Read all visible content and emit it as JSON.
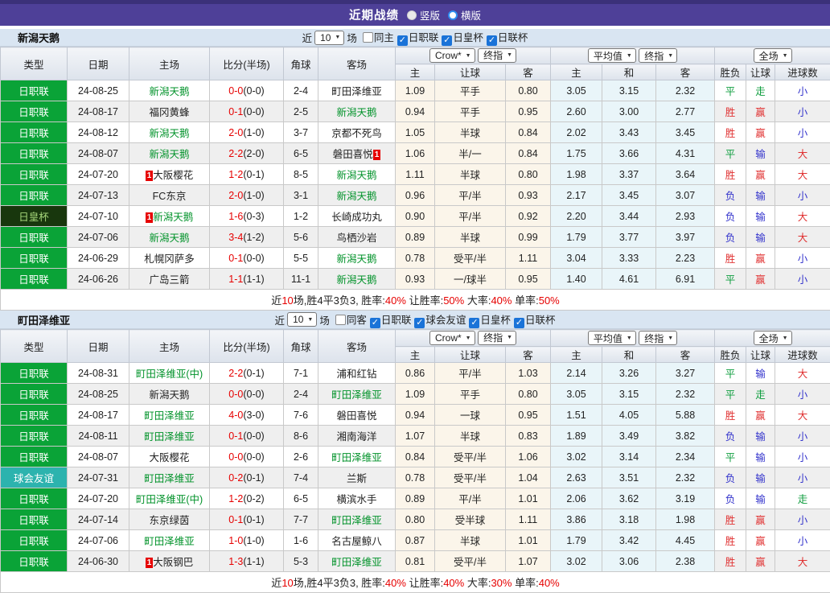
{
  "title_bar": {
    "title": "近期战绩",
    "radios": [
      {
        "label": "竖版",
        "checked": false
      },
      {
        "label": "横版",
        "checked": true
      }
    ]
  },
  "colors": {
    "titlebar_purple": "#4e4098",
    "league_green": "#0aa337",
    "cup_dark_green": "#18370d",
    "friendly_teal": "#2cb3ae",
    "focus_team_green": "#009229",
    "score_red": "#e60000",
    "win_red": "#e03131",
    "draw_green": "#0c9c3c",
    "lose_blue": "#3333cc",
    "checkbox_blue": "#1a73d8"
  },
  "columns": {
    "type": "类型",
    "date": "日期",
    "home": "主场",
    "score": "比分(半场)",
    "corner": "角球",
    "away": "客场",
    "crow_home": "主",
    "crow_handicap": "让球",
    "crow_away": "客",
    "avg_home": "主",
    "avg_draw": "和",
    "avg_away": "客",
    "res_wl": "胜负",
    "res_handicap": "让球",
    "res_goals": "进球数"
  },
  "sections": [
    {
      "team": "新潟天鹅",
      "controls": {
        "near_label": "近",
        "count": "10",
        "games_label": "场",
        "same_label": "同主",
        "same_checked": false,
        "leagues": [
          {
            "label": "日职联",
            "checked": true
          },
          {
            "label": "日皇杯",
            "checked": true
          },
          {
            "label": "日联杯",
            "checked": true
          }
        ]
      },
      "selectors": {
        "crow": "Crow*",
        "crow_idx": "终指",
        "avg": "平均值",
        "avg_idx": "终指",
        "full": "全场"
      },
      "rows": [
        {
          "type": "日职联",
          "type_style": "league",
          "date": "24-08-25",
          "home": {
            "name": "新潟天鹅",
            "focus": true,
            "badge": null
          },
          "score": "0-0",
          "half": "(0-0)",
          "corner": "2-4",
          "away": {
            "name": "町田泽维亚",
            "focus": false,
            "badge": null
          },
          "odds": [
            "1.09",
            "平手",
            "0.80",
            "3.05",
            "3.15",
            "2.32"
          ],
          "results": [
            [
              "平",
              "green"
            ],
            [
              "走",
              "green"
            ],
            [
              "小",
              "blue"
            ]
          ]
        },
        {
          "type": "日职联",
          "type_style": "league",
          "date": "24-08-17",
          "home": {
            "name": "福冈黄蜂",
            "focus": false,
            "badge": null
          },
          "score": "0-1",
          "half": "(0-0)",
          "corner": "2-5",
          "away": {
            "name": "新潟天鹅",
            "focus": true,
            "badge": null
          },
          "odds": [
            "0.94",
            "平手",
            "0.95",
            "2.60",
            "3.00",
            "2.77"
          ],
          "results": [
            [
              "胜",
              "red"
            ],
            [
              "赢",
              "red"
            ],
            [
              "小",
              "blue"
            ]
          ]
        },
        {
          "type": "日职联",
          "type_style": "league",
          "date": "24-08-12",
          "home": {
            "name": "新潟天鹅",
            "focus": true,
            "badge": null
          },
          "score": "2-0",
          "half": "(1-0)",
          "corner": "3-7",
          "away": {
            "name": "京都不死鸟",
            "focus": false,
            "badge": null
          },
          "odds": [
            "1.05",
            "半球",
            "0.84",
            "2.02",
            "3.43",
            "3.45"
          ],
          "results": [
            [
              "胜",
              "red"
            ],
            [
              "赢",
              "red"
            ],
            [
              "小",
              "blue"
            ]
          ]
        },
        {
          "type": "日职联",
          "type_style": "league",
          "date": "24-08-07",
          "home": {
            "name": "新潟天鹅",
            "focus": true,
            "badge": null
          },
          "score": "2-2",
          "half": "(2-0)",
          "corner": "6-5",
          "away": {
            "name": "磐田喜悦",
            "focus": false,
            "badge": "after"
          },
          "odds": [
            "1.06",
            "半/一",
            "0.84",
            "1.75",
            "3.66",
            "4.31"
          ],
          "results": [
            [
              "平",
              "green"
            ],
            [
              "输",
              "blue"
            ],
            [
              "大",
              "red"
            ]
          ]
        },
        {
          "type": "日职联",
          "type_style": "league",
          "date": "24-07-20",
          "home": {
            "name": "大阪樱花",
            "focus": false,
            "badge": "before"
          },
          "score": "1-2",
          "half": "(0-1)",
          "corner": "8-5",
          "away": {
            "name": "新潟天鹅",
            "focus": true,
            "badge": null
          },
          "odds": [
            "1.11",
            "半球",
            "0.80",
            "1.98",
            "3.37",
            "3.64"
          ],
          "results": [
            [
              "胜",
              "red"
            ],
            [
              "赢",
              "red"
            ],
            [
              "大",
              "red"
            ]
          ]
        },
        {
          "type": "日职联",
          "type_style": "league",
          "date": "24-07-13",
          "home": {
            "name": "FC东京",
            "focus": false,
            "badge": null
          },
          "score": "2-0",
          "half": "(1-0)",
          "corner": "3-1",
          "away": {
            "name": "新潟天鹅",
            "focus": true,
            "badge": null
          },
          "odds": [
            "0.96",
            "平/半",
            "0.93",
            "2.17",
            "3.45",
            "3.07"
          ],
          "results": [
            [
              "负",
              "blue"
            ],
            [
              "输",
              "blue"
            ],
            [
              "小",
              "blue"
            ]
          ]
        },
        {
          "type": "日皇杯",
          "type_style": "cup",
          "date": "24-07-10",
          "home": {
            "name": "新潟天鹅",
            "focus": true,
            "badge": "before"
          },
          "score": "1-6",
          "half": "(0-3)",
          "corner": "1-2",
          "away": {
            "name": "长崎成功丸",
            "focus": false,
            "badge": null
          },
          "odds": [
            "0.90",
            "平/半",
            "0.92",
            "2.20",
            "3.44",
            "2.93"
          ],
          "results": [
            [
              "负",
              "blue"
            ],
            [
              "输",
              "blue"
            ],
            [
              "大",
              "red"
            ]
          ]
        },
        {
          "type": "日职联",
          "type_style": "league",
          "date": "24-07-06",
          "home": {
            "name": "新潟天鹅",
            "focus": true,
            "badge": null
          },
          "score": "3-4",
          "half": "(1-2)",
          "corner": "5-6",
          "away": {
            "name": "鸟栖沙岩",
            "focus": false,
            "badge": null
          },
          "odds": [
            "0.89",
            "半球",
            "0.99",
            "1.79",
            "3.77",
            "3.97"
          ],
          "results": [
            [
              "负",
              "blue"
            ],
            [
              "输",
              "blue"
            ],
            [
              "大",
              "red"
            ]
          ]
        },
        {
          "type": "日职联",
          "type_style": "league",
          "date": "24-06-29",
          "home": {
            "name": "札幌冈萨多",
            "focus": false,
            "badge": null
          },
          "score": "0-1",
          "half": "(0-0)",
          "corner": "5-5",
          "away": {
            "name": "新潟天鹅",
            "focus": true,
            "badge": null
          },
          "odds": [
            "0.78",
            "受平/半",
            "1.11",
            "3.04",
            "3.33",
            "2.23"
          ],
          "results": [
            [
              "胜",
              "red"
            ],
            [
              "赢",
              "red"
            ],
            [
              "小",
              "blue"
            ]
          ]
        },
        {
          "type": "日职联",
          "type_style": "league",
          "date": "24-06-26",
          "home": {
            "name": "广岛三箭",
            "focus": false,
            "badge": null
          },
          "score": "1-1",
          "half": "(1-1)",
          "corner": "11-1",
          "away": {
            "name": "新潟天鹅",
            "focus": true,
            "badge": null
          },
          "odds": [
            "0.93",
            "一/球半",
            "0.95",
            "1.40",
            "4.61",
            "6.91"
          ],
          "results": [
            [
              "平",
              "green"
            ],
            [
              "赢",
              "red"
            ],
            [
              "小",
              "blue"
            ]
          ]
        }
      ],
      "summary": [
        [
          "近",
          "k"
        ],
        [
          "10",
          "r"
        ],
        [
          "场,胜4平3负3, 胜率:",
          "k"
        ],
        [
          "40%",
          "r"
        ],
        [
          " 让胜率:",
          "k"
        ],
        [
          "50%",
          "r"
        ],
        [
          " 大率:",
          "k"
        ],
        [
          "40%",
          "r"
        ],
        [
          " 单率:",
          "k"
        ],
        [
          "50%",
          "r"
        ]
      ]
    },
    {
      "team": "町田泽维亚",
      "controls": {
        "near_label": "近",
        "count": "10",
        "games_label": "场",
        "same_label": "同客",
        "same_checked": false,
        "leagues": [
          {
            "label": "日职联",
            "checked": true
          },
          {
            "label": "球会友谊",
            "checked": true
          },
          {
            "label": "日皇杯",
            "checked": true
          },
          {
            "label": "日联杯",
            "checked": true
          }
        ]
      },
      "selectors": {
        "crow": "Crow*",
        "crow_idx": "终指",
        "avg": "平均值",
        "avg_idx": "终指",
        "full": "全场"
      },
      "rows": [
        {
          "type": "日职联",
          "type_style": "league",
          "date": "24-08-31",
          "home": {
            "name": "町田泽维亚(中)",
            "focus": true,
            "badge": null
          },
          "score": "2-2",
          "half": "(0-1)",
          "corner": "7-1",
          "away": {
            "name": "浦和红钻",
            "focus": false,
            "badge": null
          },
          "odds": [
            "0.86",
            "平/半",
            "1.03",
            "2.14",
            "3.26",
            "3.27"
          ],
          "results": [
            [
              "平",
              "green"
            ],
            [
              "输",
              "blue"
            ],
            [
              "大",
              "red"
            ]
          ]
        },
        {
          "type": "日职联",
          "type_style": "league",
          "date": "24-08-25",
          "home": {
            "name": "新潟天鹅",
            "focus": false,
            "badge": null
          },
          "score": "0-0",
          "half": "(0-0)",
          "corner": "2-4",
          "away": {
            "name": "町田泽维亚",
            "focus": true,
            "badge": null
          },
          "odds": [
            "1.09",
            "平手",
            "0.80",
            "3.05",
            "3.15",
            "2.32"
          ],
          "results": [
            [
              "平",
              "green"
            ],
            [
              "走",
              "green"
            ],
            [
              "小",
              "blue"
            ]
          ]
        },
        {
          "type": "日职联",
          "type_style": "league",
          "date": "24-08-17",
          "home": {
            "name": "町田泽维亚",
            "focus": true,
            "badge": null
          },
          "score": "4-0",
          "half": "(3-0)",
          "corner": "7-6",
          "away": {
            "name": "磐田喜悦",
            "focus": false,
            "badge": null
          },
          "odds": [
            "0.94",
            "一球",
            "0.95",
            "1.51",
            "4.05",
            "5.88"
          ],
          "results": [
            [
              "胜",
              "red"
            ],
            [
              "赢",
              "red"
            ],
            [
              "大",
              "red"
            ]
          ]
        },
        {
          "type": "日职联",
          "type_style": "league",
          "date": "24-08-11",
          "home": {
            "name": "町田泽维亚",
            "focus": true,
            "badge": null
          },
          "score": "0-1",
          "half": "(0-0)",
          "corner": "8-6",
          "away": {
            "name": "湘南海洋",
            "focus": false,
            "badge": null
          },
          "odds": [
            "1.07",
            "半球",
            "0.83",
            "1.89",
            "3.49",
            "3.82"
          ],
          "results": [
            [
              "负",
              "blue"
            ],
            [
              "输",
              "blue"
            ],
            [
              "小",
              "blue"
            ]
          ]
        },
        {
          "type": "日职联",
          "type_style": "league",
          "date": "24-08-07",
          "home": {
            "name": "大阪樱花",
            "focus": false,
            "badge": null
          },
          "score": "0-0",
          "half": "(0-0)",
          "corner": "2-6",
          "away": {
            "name": "町田泽维亚",
            "focus": true,
            "badge": null
          },
          "odds": [
            "0.84",
            "受平/半",
            "1.06",
            "3.02",
            "3.14",
            "2.34"
          ],
          "results": [
            [
              "平",
              "green"
            ],
            [
              "输",
              "blue"
            ],
            [
              "小",
              "blue"
            ]
          ]
        },
        {
          "type": "球会友谊",
          "type_style": "friendly",
          "date": "24-07-31",
          "home": {
            "name": "町田泽维亚",
            "focus": true,
            "badge": null
          },
          "score": "0-2",
          "half": "(0-1)",
          "corner": "7-4",
          "away": {
            "name": "兰斯",
            "focus": false,
            "badge": null
          },
          "odds": [
            "0.78",
            "受平/半",
            "1.04",
            "2.63",
            "3.51",
            "2.32"
          ],
          "results": [
            [
              "负",
              "blue"
            ],
            [
              "输",
              "blue"
            ],
            [
              "小",
              "blue"
            ]
          ]
        },
        {
          "type": "日职联",
          "type_style": "league",
          "date": "24-07-20",
          "home": {
            "name": "町田泽维亚(中)",
            "focus": true,
            "badge": null
          },
          "score": "1-2",
          "half": "(0-2)",
          "corner": "6-5",
          "away": {
            "name": "横滨水手",
            "focus": false,
            "badge": null
          },
          "odds": [
            "0.89",
            "平/半",
            "1.01",
            "2.06",
            "3.62",
            "3.19"
          ],
          "results": [
            [
              "负",
              "blue"
            ],
            [
              "输",
              "blue"
            ],
            [
              "走",
              "green"
            ]
          ]
        },
        {
          "type": "日职联",
          "type_style": "league",
          "date": "24-07-14",
          "home": {
            "name": "东京绿茵",
            "focus": false,
            "badge": null
          },
          "score": "0-1",
          "half": "(0-1)",
          "corner": "7-7",
          "away": {
            "name": "町田泽维亚",
            "focus": true,
            "badge": null
          },
          "odds": [
            "0.80",
            "受半球",
            "1.11",
            "3.86",
            "3.18",
            "1.98"
          ],
          "results": [
            [
              "胜",
              "red"
            ],
            [
              "赢",
              "red"
            ],
            [
              "小",
              "blue"
            ]
          ]
        },
        {
          "type": "日职联",
          "type_style": "league",
          "date": "24-07-06",
          "home": {
            "name": "町田泽维亚",
            "focus": true,
            "badge": null
          },
          "score": "1-0",
          "half": "(1-0)",
          "corner": "1-6",
          "away": {
            "name": "名古屋鲸八",
            "focus": false,
            "badge": null
          },
          "odds": [
            "0.87",
            "半球",
            "1.01",
            "1.79",
            "3.42",
            "4.45"
          ],
          "results": [
            [
              "胜",
              "red"
            ],
            [
              "赢",
              "red"
            ],
            [
              "小",
              "blue"
            ]
          ]
        },
        {
          "type": "日职联",
          "type_style": "league",
          "date": "24-06-30",
          "home": {
            "name": "大阪钢巴",
            "focus": false,
            "badge": "before"
          },
          "score": "1-3",
          "half": "(1-1)",
          "corner": "5-3",
          "away": {
            "name": "町田泽维亚",
            "focus": true,
            "badge": null
          },
          "odds": [
            "0.81",
            "受平/半",
            "1.07",
            "3.02",
            "3.06",
            "2.38"
          ],
          "results": [
            [
              "胜",
              "red"
            ],
            [
              "赢",
              "red"
            ],
            [
              "大",
              "red"
            ]
          ]
        }
      ],
      "summary": [
        [
          "近",
          "k"
        ],
        [
          "10",
          "r"
        ],
        [
          "场,胜4平3负3, 胜率:",
          "k"
        ],
        [
          "40%",
          "r"
        ],
        [
          " 让胜率:",
          "k"
        ],
        [
          "40%",
          "r"
        ],
        [
          " 大率:",
          "k"
        ],
        [
          "30%",
          "r"
        ],
        [
          " 单率:",
          "k"
        ],
        [
          "40%",
          "r"
        ]
      ]
    }
  ]
}
